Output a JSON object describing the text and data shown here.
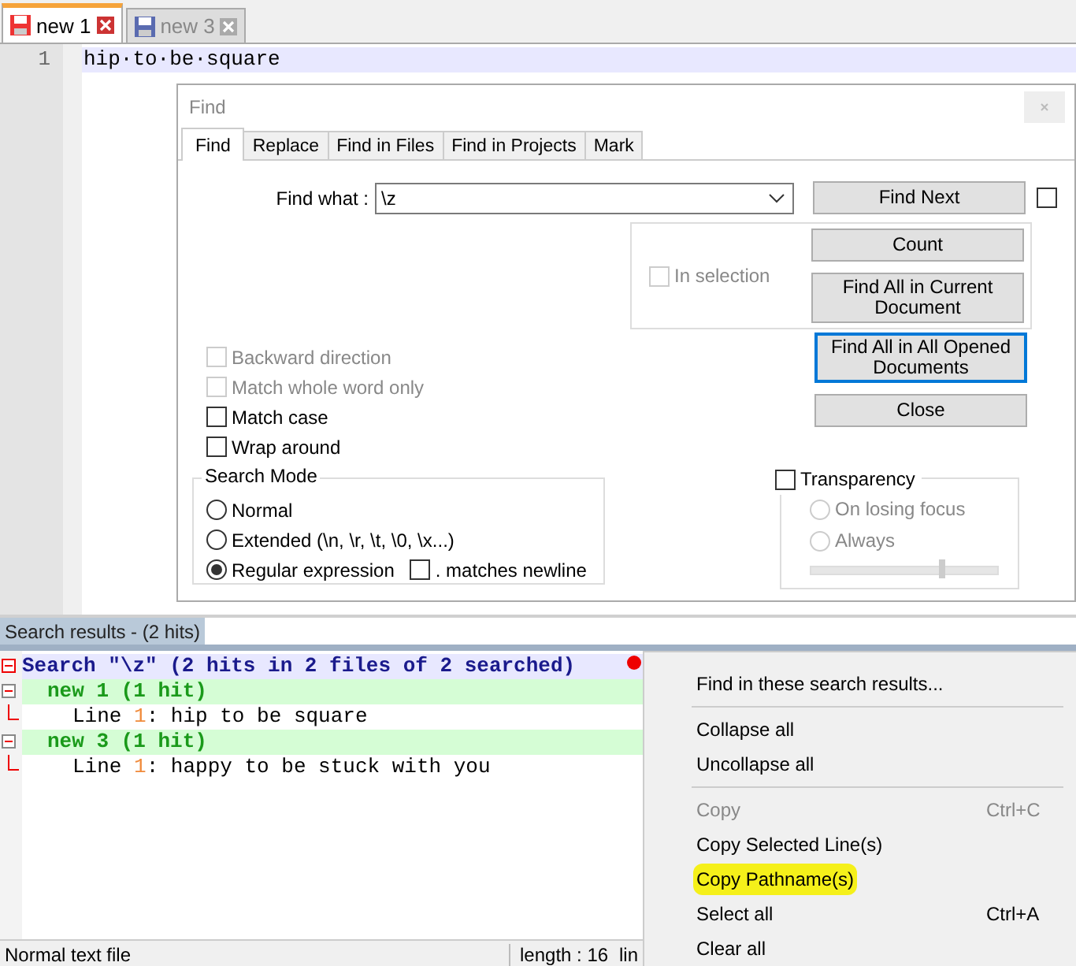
{
  "tabs": [
    {
      "label": "new 1",
      "selected": true
    },
    {
      "label": "new 3",
      "selected": false
    }
  ],
  "editor": {
    "lines": [
      {
        "number": "1",
        "text": "hip·to·be·square",
        "current": true
      }
    ]
  },
  "find_dialog": {
    "title": "Find",
    "tabs": [
      {
        "label": "Find",
        "selected": true
      },
      {
        "label": "Replace",
        "selected": false
      },
      {
        "label": "Find in Files",
        "selected": false
      },
      {
        "label": "Find in Projects",
        "selected": false
      },
      {
        "label": "Mark",
        "selected": false
      }
    ],
    "find_what": {
      "label": "Find what :",
      "value": "\\z"
    },
    "find_next": {
      "label": "Find Next",
      "focused": false
    },
    "side_checkbox": {
      "checked": false
    },
    "in_selection": {
      "label": "In selection",
      "checked": false,
      "disabled": true
    },
    "count": {
      "label": "Count",
      "focused": false
    },
    "find_all_current": {
      "label": "Find All in Current Document",
      "focused": false
    },
    "find_all_opened": {
      "label": "Find All in All Opened Documents",
      "focused": true
    },
    "close": {
      "label": "Close",
      "focused": false
    },
    "options": [
      {
        "label": "Backward direction",
        "checked": false,
        "disabled": true
      },
      {
        "label": "Match whole word only",
        "checked": false,
        "disabled": true
      },
      {
        "label": "Match case",
        "checked": false,
        "disabled": false
      },
      {
        "label": "Wrap around",
        "checked": false,
        "disabled": false
      }
    ],
    "search_mode": {
      "title": "Search Mode",
      "options": [
        {
          "label": "Normal",
          "selected": false
        },
        {
          "label": "Extended (\\n, \\r, \\t, \\0, \\x...)",
          "selected": false
        },
        {
          "label": "Regular expression",
          "selected": true
        }
      ],
      "matches_newline": {
        "label": ". matches newline",
        "checked": false
      }
    },
    "transparency": {
      "label": "Transparency",
      "checked": false,
      "options": [
        {
          "label": "On losing focus",
          "selected": false,
          "disabled": true
        },
        {
          "label": "Always",
          "selected": false,
          "disabled": true
        }
      ],
      "slider": {
        "level": 0.7,
        "disabled": true
      }
    }
  },
  "results": {
    "header": "Search results - (2 hits)",
    "search": {
      "label": "Search \"\\z\" (2 hits in 2 files of 2 searched)",
      "expanded": true,
      "children": [
        {
          "label": "new 1 (1 hit)",
          "expanded": true,
          "children": [
            {
              "prefix": "Line ",
              "number": "1",
              "text": ": hip to be square"
            }
          ]
        },
        {
          "label": "new 3 (1 hit)",
          "expanded": true,
          "children": [
            {
              "prefix": "Line ",
              "number": "1",
              "text": ": happy to be stuck with you"
            }
          ]
        }
      ]
    }
  },
  "status_bar": [
    {
      "text": "Normal text file"
    },
    {
      "text": "length : 16"
    },
    {
      "text": "lin"
    }
  ],
  "context_menu": {
    "items": [
      {
        "kind": "item",
        "label": "Find in these search results...",
        "disabled": false,
        "highlighted": false
      },
      {
        "kind": "separator"
      },
      {
        "kind": "item",
        "label": "Collapse all",
        "disabled": false,
        "highlighted": false
      },
      {
        "kind": "item",
        "label": "Uncollapse all",
        "disabled": false,
        "highlighted": false
      },
      {
        "kind": "separator"
      },
      {
        "kind": "item",
        "label": "Copy",
        "shortcut": "Ctrl+C",
        "disabled": true,
        "highlighted": false
      },
      {
        "kind": "item",
        "label": "Copy Selected Line(s)",
        "disabled": false,
        "highlighted": false
      },
      {
        "kind": "item",
        "label": "Copy Pathname(s)",
        "disabled": false,
        "highlighted": true
      },
      {
        "kind": "item",
        "label": "Select all",
        "shortcut": "Ctrl+A",
        "disabled": false,
        "highlighted": false
      },
      {
        "kind": "item",
        "label": "Clear all",
        "disabled": false,
        "highlighted": false
      }
    ]
  }
}
